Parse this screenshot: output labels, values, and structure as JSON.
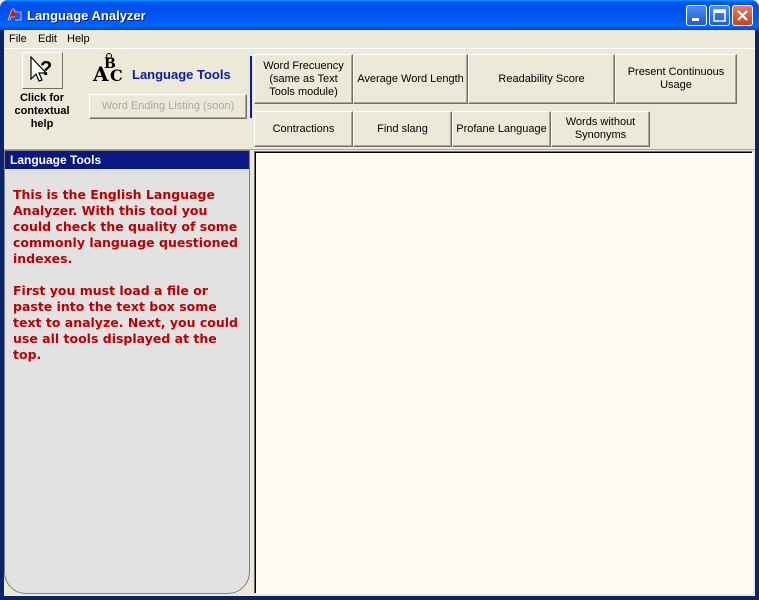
{
  "window": {
    "title": "Language Analyzer"
  },
  "menu": {
    "items": [
      "File",
      "Edit",
      "Help"
    ]
  },
  "toolbar": {
    "help_label": "Click for contextual help",
    "section_title": "Language Tools",
    "word_ending_button": "Word Ending Listing (soon)",
    "tools_row1": [
      "Word Frecuency (same as Text Tools module)",
      "Average Word Length",
      "Readability Score",
      "Present Continuous Usage"
    ],
    "tools_row2": [
      "Contractions",
      "Find slang",
      "Profane Language",
      "Words without Synonyms"
    ]
  },
  "left_panel": {
    "header": "Language Tools",
    "paragraph1": "This is the English Language Analyzer. With this tool you could check the quality of some commonly language questioned indexes.",
    "paragraph2": "First you must load a file or paste into the text box some text to analyze. Next, you could use all tools displayed at the top."
  },
  "editor": {
    "content": ""
  },
  "colors": {
    "title_bar": "#0053ee",
    "panel_header": "#0a1883",
    "panel_text": "#c00000",
    "accent_title": "#0a1bb4",
    "editor_bg": "#fffbf0"
  },
  "icons": {
    "app": "app-icon",
    "help": "help-cursor-icon",
    "section": "abc-icon"
  }
}
